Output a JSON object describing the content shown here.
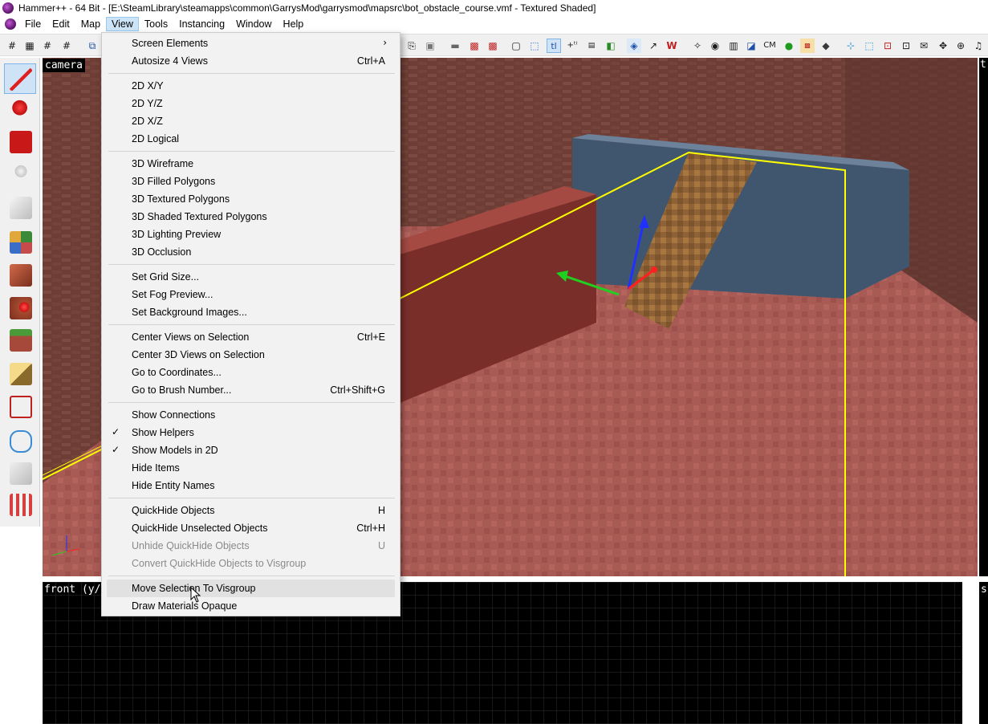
{
  "window": {
    "title": "Hammer++ - 64 Bit - [E:\\SteamLibrary\\steamapps\\common\\GarrysMod\\garrysmod\\mapsrc\\bot_obstacle_course.vmf - Textured Shaded]"
  },
  "menubar": {
    "items": [
      {
        "label": "File"
      },
      {
        "label": "Edit"
      },
      {
        "label": "Map"
      },
      {
        "label": "View"
      },
      {
        "label": "Tools"
      },
      {
        "label": "Instancing"
      },
      {
        "label": "Window"
      },
      {
        "label": "Help"
      }
    ]
  },
  "toolbar": {
    "icons": [
      "grid-icon",
      "grid-dots-icon",
      "grid-smaller-icon",
      "grid-larger-icon",
      "cameras-icon",
      "copy-icon",
      "paste-icon",
      "carve-icon",
      "texture-lock-icon",
      "select-icon",
      "tl-icon",
      "group-icon",
      "ungroup-icon",
      "lock-icon",
      "hide-icon",
      "cordon-icon",
      "models-icon",
      "run-map-icon",
      "cm-icon",
      "lighting-icon",
      "nodraw-icon",
      "compile-icon",
      "move-icon",
      "snap-icon",
      "flags-icon",
      "ab-icon",
      "entity-icon",
      "cursor-icon"
    ],
    "labels": {
      "tl": "tl",
      "cm": "CM"
    }
  },
  "palette": {
    "tools": [
      "selection-tool-icon",
      "magnify-tool-icon",
      "camera-tool-icon",
      "entity-tool-icon",
      "block-tool-icon",
      "texture-application-icon",
      "apply-texture-icon",
      "decal-tool-icon",
      "overlay-tool-icon",
      "clipping-tool-icon",
      "vertex-tool-icon",
      "path-tool-icon",
      "sprinkle-tool-icon",
      "terrain-tool-icon"
    ]
  },
  "viewports": {
    "camera_label": "camera",
    "front_label": "front (y/z)",
    "right_top_label": "t",
    "right_bottom_label": "s"
  },
  "view_menu": {
    "items": [
      {
        "label": "Screen Elements",
        "shortcut": "",
        "submenu": true
      },
      {
        "label": "Autosize 4 Views",
        "shortcut": "Ctrl+A"
      },
      {
        "label": "2D X/Y",
        "shortcut": ""
      },
      {
        "label": "2D Y/Z",
        "shortcut": ""
      },
      {
        "label": "2D X/Z",
        "shortcut": ""
      },
      {
        "label": "2D Logical",
        "shortcut": ""
      },
      {
        "label": "3D Wireframe",
        "shortcut": ""
      },
      {
        "label": "3D Filled Polygons",
        "shortcut": ""
      },
      {
        "label": "3D Textured Polygons",
        "shortcut": ""
      },
      {
        "label": "3D Shaded Textured Polygons",
        "shortcut": ""
      },
      {
        "label": "3D Lighting Preview",
        "shortcut": ""
      },
      {
        "label": "3D Occlusion",
        "shortcut": ""
      },
      {
        "label": "Set Grid Size...",
        "shortcut": ""
      },
      {
        "label": "Set Fog Preview...",
        "shortcut": ""
      },
      {
        "label": "Set Background Images...",
        "shortcut": ""
      },
      {
        "label": "Center Views on Selection",
        "shortcut": "Ctrl+E"
      },
      {
        "label": "Center 3D Views on Selection",
        "shortcut": ""
      },
      {
        "label": "Go to Coordinates...",
        "shortcut": ""
      },
      {
        "label": "Go to Brush Number...",
        "shortcut": "Ctrl+Shift+G"
      },
      {
        "label": "Show Connections",
        "shortcut": ""
      },
      {
        "label": "Show Helpers",
        "shortcut": "",
        "checked": true
      },
      {
        "label": "Show Models in 2D",
        "shortcut": "",
        "checked": true
      },
      {
        "label": "Hide Items",
        "shortcut": ""
      },
      {
        "label": "Hide Entity Names",
        "shortcut": ""
      },
      {
        "label": "QuickHide Objects",
        "shortcut": "H"
      },
      {
        "label": "QuickHide Unselected Objects",
        "shortcut": "Ctrl+H"
      },
      {
        "label": "Unhide QuickHide Objects",
        "shortcut": "U",
        "disabled": true
      },
      {
        "label": "Convert QuickHide Objects to Visgroup",
        "shortcut": "",
        "disabled": true
      },
      {
        "label": "Move Selection To Visgroup",
        "shortcut": "",
        "hover": true
      },
      {
        "label": "Draw Materials Opaque",
        "shortcut": ""
      }
    ],
    "check_glyph": "✓",
    "submenu_glyph": "›"
  },
  "colors": {
    "selection_outline": "#ffff00",
    "gizmo_x": "#ff2020",
    "gizmo_y": "#20d020",
    "gizmo_z": "#2030ff",
    "grid_line": "#3a3a3a"
  }
}
